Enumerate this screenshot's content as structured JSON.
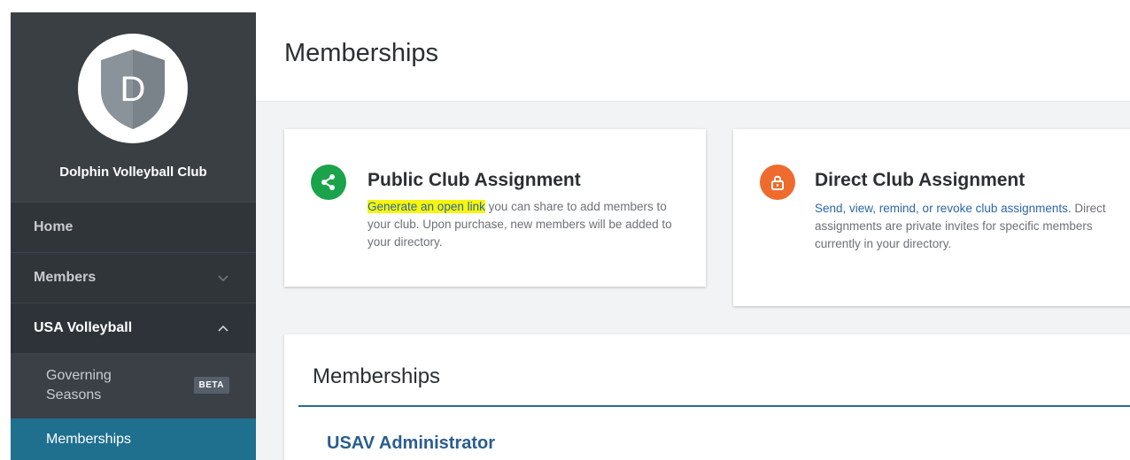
{
  "sidebar": {
    "logo_letter": "D",
    "club_name": "Dolphin Volleyball Club",
    "items": {
      "home": "Home",
      "members": "Members",
      "usa_volleyball": "USA Volleyball",
      "governing_seasons": "Governing Seasons",
      "governing_badge": "BETA",
      "memberships": "Memberships"
    }
  },
  "main": {
    "title": "Memberships",
    "cards": {
      "public": {
        "title": "Public Club Assignment",
        "link_text": "Generate an open link",
        "desc_rest": " you can share to add members to your club. Upon purchase, new members will be added to your directory.",
        "icon": "share-icon",
        "color": "#1aa34a"
      },
      "direct": {
        "title": "Direct Club Assignment",
        "link_text": "Send, view, remind, or revoke club assignments.",
        "desc_rest": " Direct assignments are private invites for specific members currently in your directory.",
        "icon": "lock-icon",
        "color": "#ee6b2d"
      }
    },
    "memberships_panel": {
      "title": "Memberships",
      "first_item": "USAV Administrator"
    }
  },
  "colors": {
    "sidebar_bg": "#3a3f44",
    "active_bg": "#1f6f8f",
    "highlight": "#f7f50c",
    "link": "#2b66a8"
  }
}
